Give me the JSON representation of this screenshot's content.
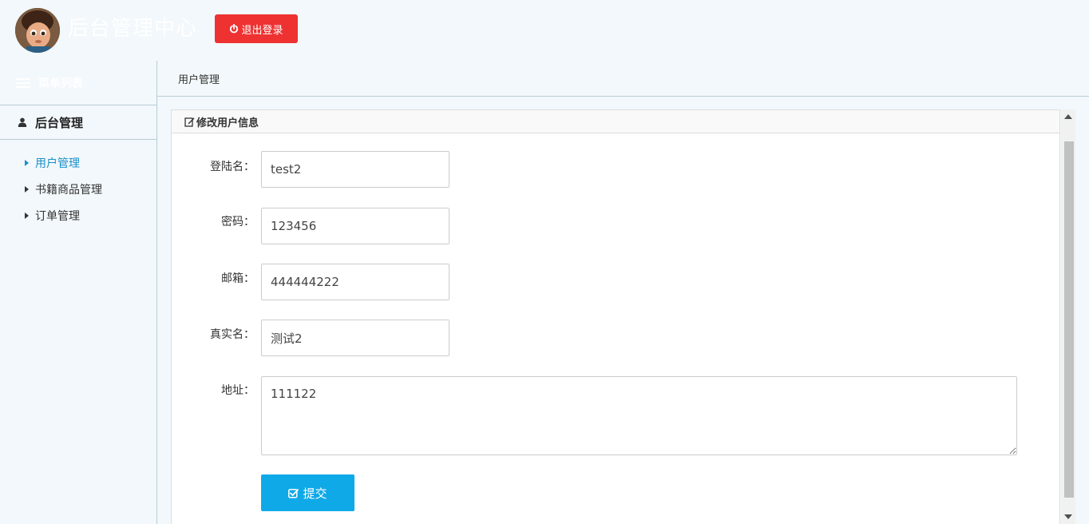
{
  "header": {
    "title": "后台管理中心",
    "logout_label": "退出登录",
    "logout_color": "#ee3131"
  },
  "sidebar": {
    "menu_title": "菜单列表",
    "group_title": "后台管理",
    "items": [
      {
        "label": "用户管理",
        "active": true
      },
      {
        "label": "书籍商品管理",
        "active": false
      },
      {
        "label": "订单管理",
        "active": false
      }
    ],
    "active_color": "#1a8fc9"
  },
  "breadcrumb": {
    "current": "用户管理"
  },
  "panel": {
    "title": "修改用户信息"
  },
  "form": {
    "login_name": {
      "label": "登陆名：",
      "value": "test2"
    },
    "password": {
      "label": "密码：",
      "value": "123456"
    },
    "email": {
      "label": "邮箱：",
      "value": "444444222"
    },
    "real_name": {
      "label": "真实名：",
      "value": "测试2"
    },
    "address": {
      "label": "地址：",
      "value": "111122"
    },
    "submit_label": "提交",
    "submit_color": "#0fa9e8"
  }
}
